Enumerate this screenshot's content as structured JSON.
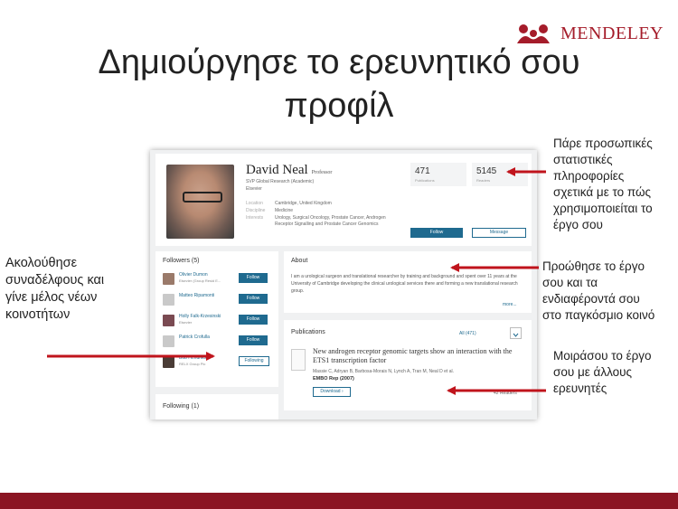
{
  "brand": {
    "name": "MENDELEY",
    "color": "#a51c2a",
    "icon": "mendeley-logo-icon"
  },
  "title": {
    "line1": "Δημιούργησε το ερευνητικό σου",
    "line2": "προφίλ"
  },
  "colors": {
    "arrow": "#c0141c",
    "bottom_bar": "#8b1523",
    "button": "#1f6a8f"
  },
  "profile": {
    "name": "David Neal",
    "role": "Professor",
    "position": "SVP Global Research (Academic)",
    "employer": "Elsevier",
    "location_label": "Location",
    "location": "Cambridge, United Kingdom",
    "discipline_label": "Discipline",
    "discipline": "Medicine",
    "interests_label": "Interests",
    "interests": "Urology, Surgical Oncology, Prostate Cancer, Androgen Receptor Signalling and Prostate Cancer Genomics",
    "publications_count": "471",
    "publications_label": "Publications",
    "readers_count": "5145",
    "readers_label": "Readers",
    "follow_label": "Follow",
    "message_label": "Message"
  },
  "followers": {
    "title": "Followers (5)",
    "items": [
      {
        "name": "Olivier Dumon",
        "sub": "Elsevier (Group Resid E...",
        "button": "Follow"
      },
      {
        "name": "Matteo Ripamonti",
        "sub": "",
        "button": "Follow"
      },
      {
        "name": "Holly Falk-Krzesinski",
        "sub": "Elsevier",
        "button": "Follow"
      },
      {
        "name": "Patrick Crofulla",
        "sub": "",
        "button": "Follow"
      },
      {
        "name": "Bob Hendriks",
        "sub": "RELX Group Plc",
        "button": "Following"
      }
    ]
  },
  "following": {
    "title": "Following (1)"
  },
  "about": {
    "title": "About",
    "text": "I am a urological surgeon and translational researcher by training and background and spent over 11 years at the University of Cambridge developing the clinical urological services there and forming a new translational research group.",
    "more": "more..."
  },
  "publications": {
    "title": "Publications",
    "filter": "All (471)",
    "item_title": "New androgen receptor genomic targets show an interaction with the ETS1 transcription factor",
    "item_authors": "Massie C, Adryan B, Barbosa-Morais N, Lynch A, Tran M, Neal D et al.",
    "item_journal": "EMBO Rep (2007)",
    "download": "Download",
    "readers": "42 Readers"
  },
  "annotations": {
    "stats": [
      "Πάρε προσωπικές",
      "στατιστικές",
      "πληροφορίες",
      "σχετικά με το πώς",
      "χρησιμοποιείται το",
      "έργο σου"
    ],
    "promote": [
      "Προώθησε το έργο",
      "σου και τα",
      "ενδιαφέροντά σου",
      "στο παγκόσμιο κοινό"
    ],
    "share": [
      "Μοιράσου το έργο",
      "σου με άλλους",
      "ερευνητές"
    ],
    "follow": [
      "Ακολούθησε",
      "συναδέλφους και",
      "γίνε μέλος νέων",
      "κοινοτήτων"
    ]
  }
}
